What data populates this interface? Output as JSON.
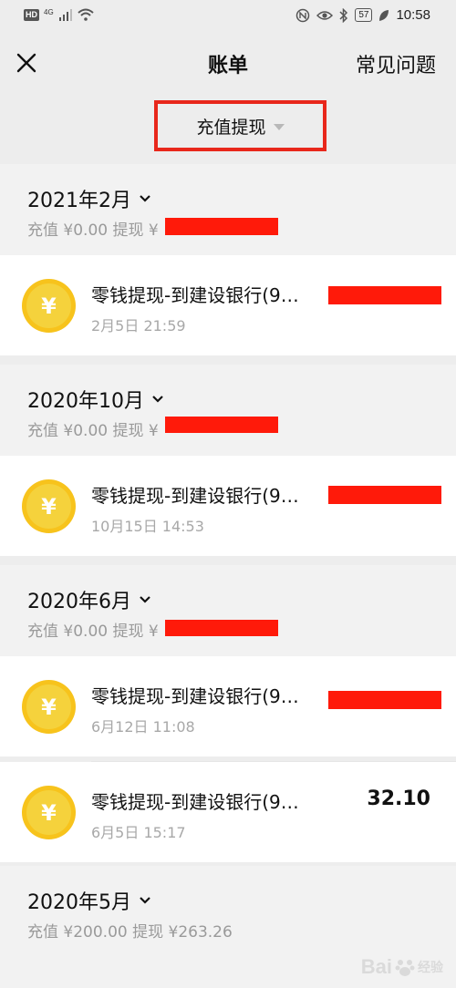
{
  "status_bar": {
    "left_badge": "HD",
    "network": "4G",
    "battery": "57",
    "time": "10:58"
  },
  "nav": {
    "title": "账单",
    "faq_label": "常见问题",
    "close_icon": "close-icon"
  },
  "filter": {
    "label": "充值提现",
    "highlight_color": "#e8271b"
  },
  "months": [
    {
      "label": "2021年2月",
      "recharge": "充值 ¥0.00",
      "withdraw": "提现 ¥"
    },
    {
      "label": "2020年10月",
      "recharge": "充值 ¥0.00",
      "withdraw": "提现 ¥"
    },
    {
      "label": "2020年6月",
      "recharge": "充值 ¥0.00",
      "withdraw": "提现 ¥"
    },
    {
      "label": "2020年5月",
      "recharge": "充值 ¥200.00",
      "withdraw": "提现 ¥263.26"
    }
  ],
  "transactions": [
    {
      "title": "零钱提现-到建设银行(9…",
      "time": "2月5日 21:59",
      "amount": ""
    },
    {
      "title": "零钱提现-到建设银行(9…",
      "time": "10月15日 14:53",
      "amount": ""
    },
    {
      "title": "零钱提现-到建设银行(9…",
      "time": "6月12日 11:08",
      "amount": ""
    },
    {
      "title": "零钱提现-到建设银行(9…",
      "time": "6月5日 15:17",
      "amount": "32.10"
    }
  ],
  "coin_symbol": "¥",
  "colors": {
    "coin": "#f7c31c",
    "redaction": "#ff1a0a",
    "background": "#ededed"
  },
  "watermark": {
    "brand": "Bai",
    "sub": "经验"
  }
}
